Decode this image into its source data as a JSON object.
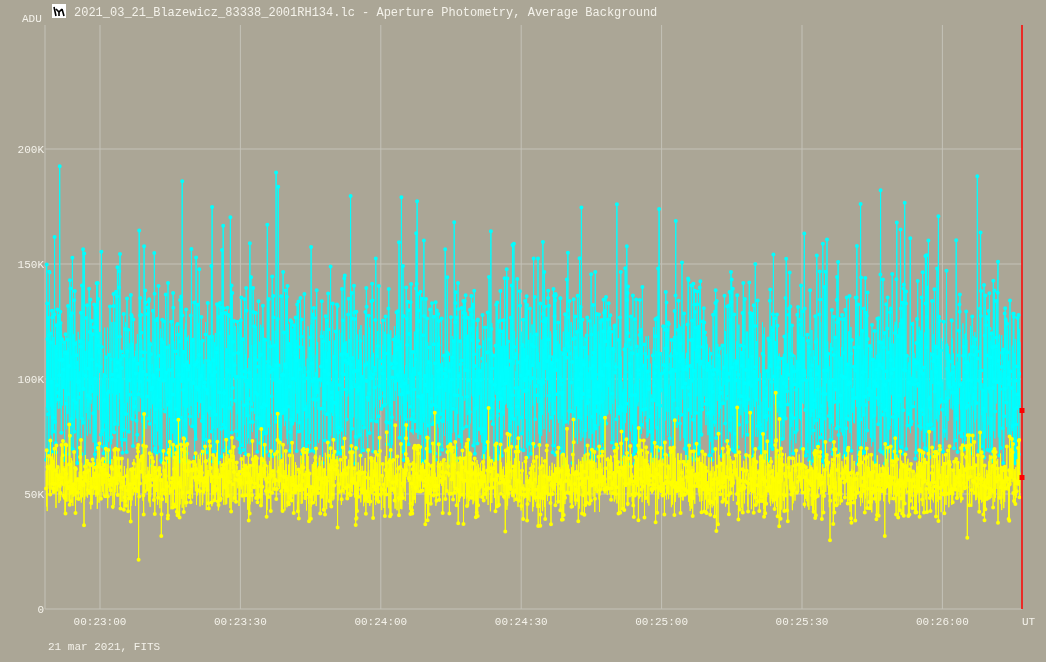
{
  "window": {
    "title": "2021_03_21_Blazewicz_83338_2001RH134.lc - Aperture Photometry, Average Background"
  },
  "chart": {
    "y_unit": "ADU",
    "y_ticks": [
      "200K",
      "150K",
      "100K",
      "50K",
      "0"
    ],
    "x_ticks": [
      "00:23:00",
      "00:23:30",
      "00:24:00",
      "00:24:30",
      "00:25:00",
      "00:25:30",
      "00:26:00"
    ],
    "x_unit": "UT",
    "series": [
      {
        "color": "#00ffff"
      },
      {
        "color": "#ffff00"
      }
    ]
  },
  "footer": "21 mar 2021, FITS"
}
